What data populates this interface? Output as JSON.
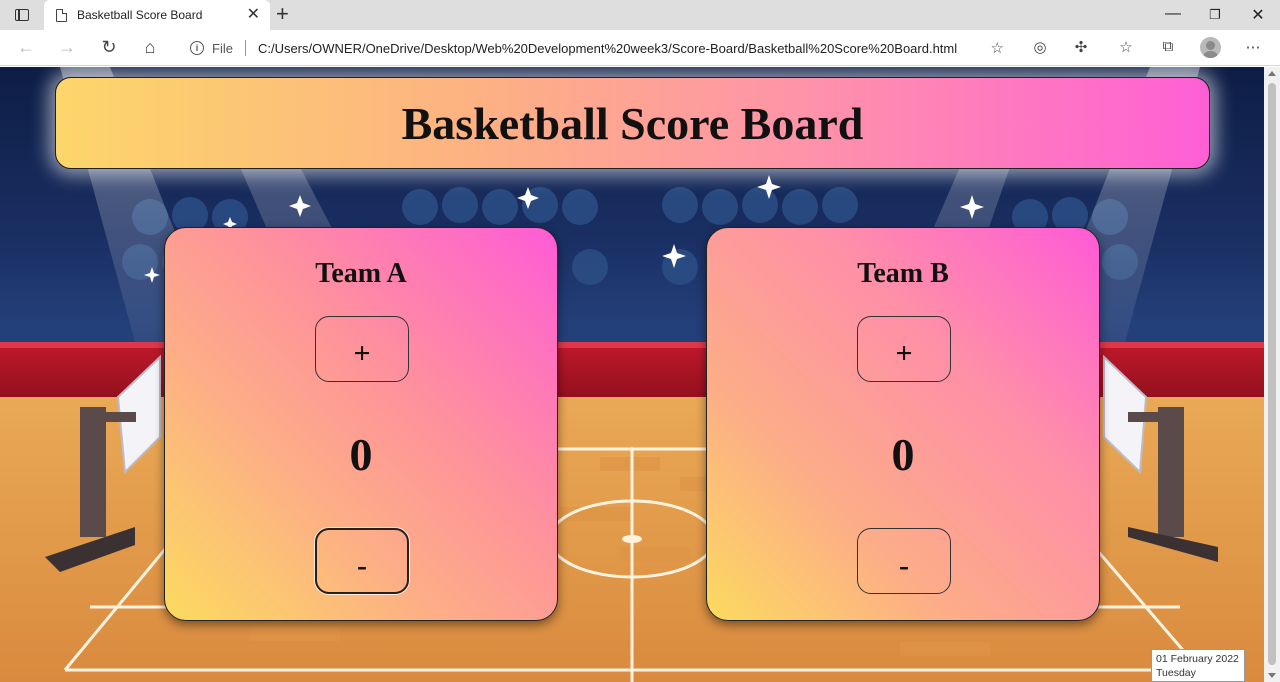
{
  "browser": {
    "tab_title": "Basketball Score Board",
    "address_prefix": "File",
    "url": "C:/Users/OWNER/OneDrive/Desktop/Web%20Development%20week3/Score-Board/Basketball%20Score%20Board.html",
    "icons": [
      "tab-actions-icon",
      "page-icon",
      "close-icon",
      "plus-icon",
      "minimize-icon",
      "restore-icon",
      "back-icon",
      "forward-icon",
      "refresh-icon",
      "home-icon",
      "info-icon",
      "favorite-add-icon",
      "tracking-icon",
      "extensions-icon",
      "favorites-icon",
      "collections-icon",
      "profile-icon",
      "more-icon"
    ]
  },
  "page": {
    "title": "Basketball Score Board",
    "teams": [
      {
        "name": "Team A",
        "plus_label": "+",
        "minus_label": "-",
        "score": "0"
      },
      {
        "name": "Team B",
        "plus_label": "+",
        "minus_label": "-",
        "score": "0"
      }
    ]
  },
  "taskbar_tooltip": {
    "date": "01 February 2022",
    "day": "Tuesday"
  },
  "colors": {
    "banner_gradient": [
      "#fcd66a",
      "#ff5fd5"
    ],
    "card_gradient": [
      "#fbdb5f",
      "#ff5bd7"
    ],
    "sky": "#0d1d45",
    "court": "#e8a050"
  }
}
